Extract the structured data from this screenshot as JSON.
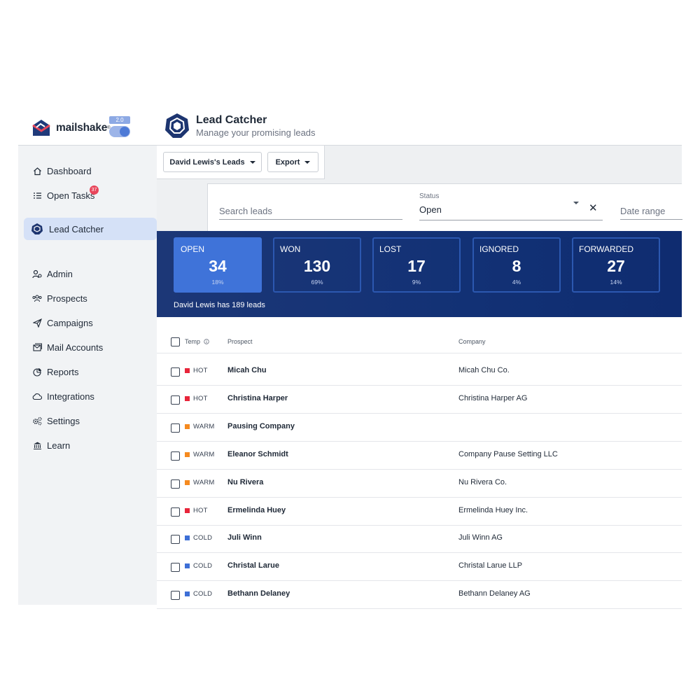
{
  "app": {
    "brand": "mailshake",
    "version": "2.0"
  },
  "page": {
    "title": "Lead Catcher",
    "subtitle": "Manage your promising leads"
  },
  "sidebar": {
    "items": [
      {
        "label": "Dashboard",
        "icon": "home-icon"
      },
      {
        "label": "Open Tasks",
        "icon": "task-list-icon",
        "badge": "37"
      },
      {
        "label": "Lead Catcher",
        "icon": "lead-catcher-icon",
        "active": true
      },
      {
        "label": "Admin",
        "icon": "admin-icon"
      },
      {
        "label": "Prospects",
        "icon": "people-icon"
      },
      {
        "label": "Campaigns",
        "icon": "paper-plane-icon"
      },
      {
        "label": "Mail Accounts",
        "icon": "mail-accounts-icon"
      },
      {
        "label": "Reports",
        "icon": "pie-chart-icon"
      },
      {
        "label": "Integrations",
        "icon": "cloud-icon"
      },
      {
        "label": "Settings",
        "icon": "gears-icon"
      },
      {
        "label": "Learn",
        "icon": "institution-icon"
      }
    ]
  },
  "toolbar": {
    "leads_owner": "David Lewis's Leads",
    "export": "Export"
  },
  "filters": {
    "search_placeholder": "Search leads",
    "status_label": "Status",
    "status_value": "Open",
    "clear": "✕",
    "date_placeholder": "Date range"
  },
  "stats": {
    "cards": [
      {
        "label": "OPEN",
        "value": "34",
        "pct": "18%",
        "active": true
      },
      {
        "label": "WON",
        "value": "130",
        "pct": "69%"
      },
      {
        "label": "LOST",
        "value": "17",
        "pct": "9%"
      },
      {
        "label": "IGNORED",
        "value": "8",
        "pct": "4%"
      },
      {
        "label": "FORWARDED",
        "value": "27",
        "pct": "14%"
      }
    ],
    "footer": "David Lewis has 189 leads"
  },
  "table": {
    "columns": {
      "temp": "Temp",
      "prospect": "Prospect",
      "company": "Company"
    },
    "temp_colors": {
      "HOT": "#e8253a",
      "WARM": "#f58a1f",
      "COLD": "#3d6fd6"
    },
    "rows": [
      {
        "temp": "HOT",
        "prospect": "Micah Chu",
        "company": "Micah Chu Co."
      },
      {
        "temp": "HOT",
        "prospect": "Christina Harper",
        "company": "Christina Harper AG"
      },
      {
        "temp": "WARM",
        "prospect": "Pausing Company",
        "company": ""
      },
      {
        "temp": "WARM",
        "prospect": "Eleanor Schmidt",
        "company": "Company Pause Setting LLC"
      },
      {
        "temp": "WARM",
        "prospect": "Nu Rivera",
        "company": "Nu Rivera Co."
      },
      {
        "temp": "HOT",
        "prospect": "Ermelinda Huey",
        "company": "Ermelinda Huey Inc."
      },
      {
        "temp": "COLD",
        "prospect": "Juli Winn",
        "company": "Juli Winn AG"
      },
      {
        "temp": "COLD",
        "prospect": "Christal Larue",
        "company": "Christal Larue LLP"
      },
      {
        "temp": "COLD",
        "prospect": "Bethann Delaney",
        "company": "Bethann Delaney AG"
      }
    ]
  }
}
